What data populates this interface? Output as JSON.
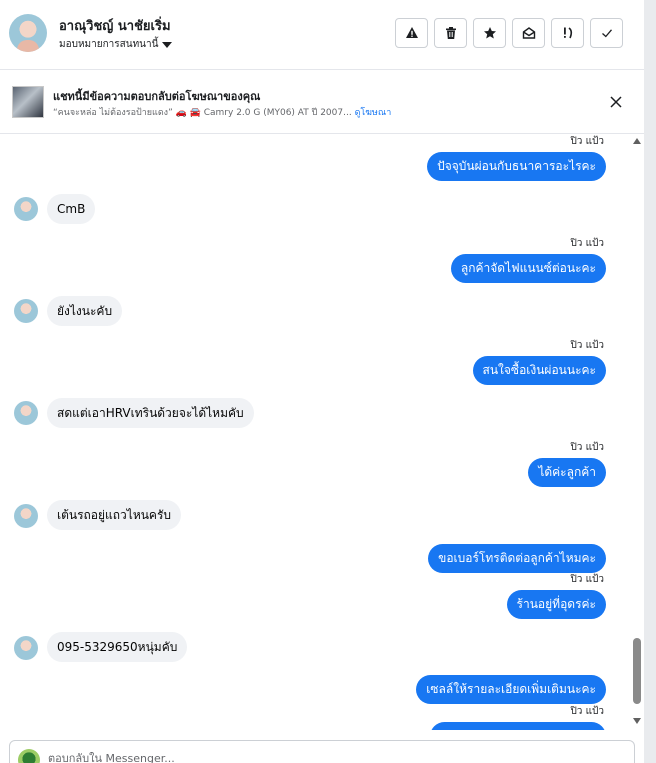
{
  "contact": {
    "name": "อาณุวิชญ์ นาชัยเริ่ม",
    "assign_label": "มอบหมายการสนทนานี้"
  },
  "header_actions": [
    {
      "icon": "warning-icon"
    },
    {
      "icon": "trash-icon"
    },
    {
      "icon": "star-icon"
    },
    {
      "icon": "mark-unread-icon"
    },
    {
      "icon": "follow-up-icon"
    },
    {
      "icon": "check-icon"
    }
  ],
  "ad": {
    "title": "แชทนี้มีข้อความตอบกลับต่อโฆษณาของคุณ",
    "subtitle": "“คนจะหล่อ ไม่ต้องรอป้ายแดง” 🚗 🚘 Camry 2.0 G (MY06) AT ปี 2007...",
    "link": "ดูโฆษณา"
  },
  "messages": [
    {
      "dir": "out",
      "seen": "ปิว แป้ว",
      "text": "ปัจจุบันผ่อนกับธนาคารอะไรคะ"
    },
    {
      "dir": "in",
      "text": "CmB"
    },
    {
      "dir": "out",
      "seen": "ปิว แป้ว",
      "text": "ลูกค้าจัดไฟแนนซ์ต่อนะคะ"
    },
    {
      "dir": "in",
      "text": "ยังไงนะคับ"
    },
    {
      "dir": "out",
      "seen": "ปิว แป้ว",
      "text": "สนใจซื้อเงินผ่อนนะคะ"
    },
    {
      "dir": "in",
      "text": "สดแต่เอาHRVเทรินด้วยจะได้ไหมคับ"
    },
    {
      "dir": "out",
      "seen": "ปิว แป้ว",
      "text": "ได้ค่ะลูกค้า"
    },
    {
      "dir": "in",
      "text": "เต้นรถอยู่แถวไหนครับ"
    },
    {
      "dir": "out",
      "text": "ขอเบอร์โทรติดต่อลูกค้าไหมคะ"
    },
    {
      "dir": "out",
      "seen": "ปิว แป้ว",
      "text": "ร้านอยู่ที่อุดรค่ะ"
    },
    {
      "dir": "in",
      "text": "095-5329650หนุ่มคับ"
    },
    {
      "dir": "out",
      "text": "เซลล์ให้รายละเอียดเพิ่มเติมนะคะ"
    },
    {
      "dir": "out",
      "seen": "ปิว แป้ว",
      "text": ""
    }
  ],
  "composer": {
    "placeholder": "ตอบกลับใน Messenger..."
  },
  "colors": {
    "outgoing_bubble": "#1877f2",
    "incoming_bubble": "#f0f2f5",
    "link": "#1877f2"
  }
}
